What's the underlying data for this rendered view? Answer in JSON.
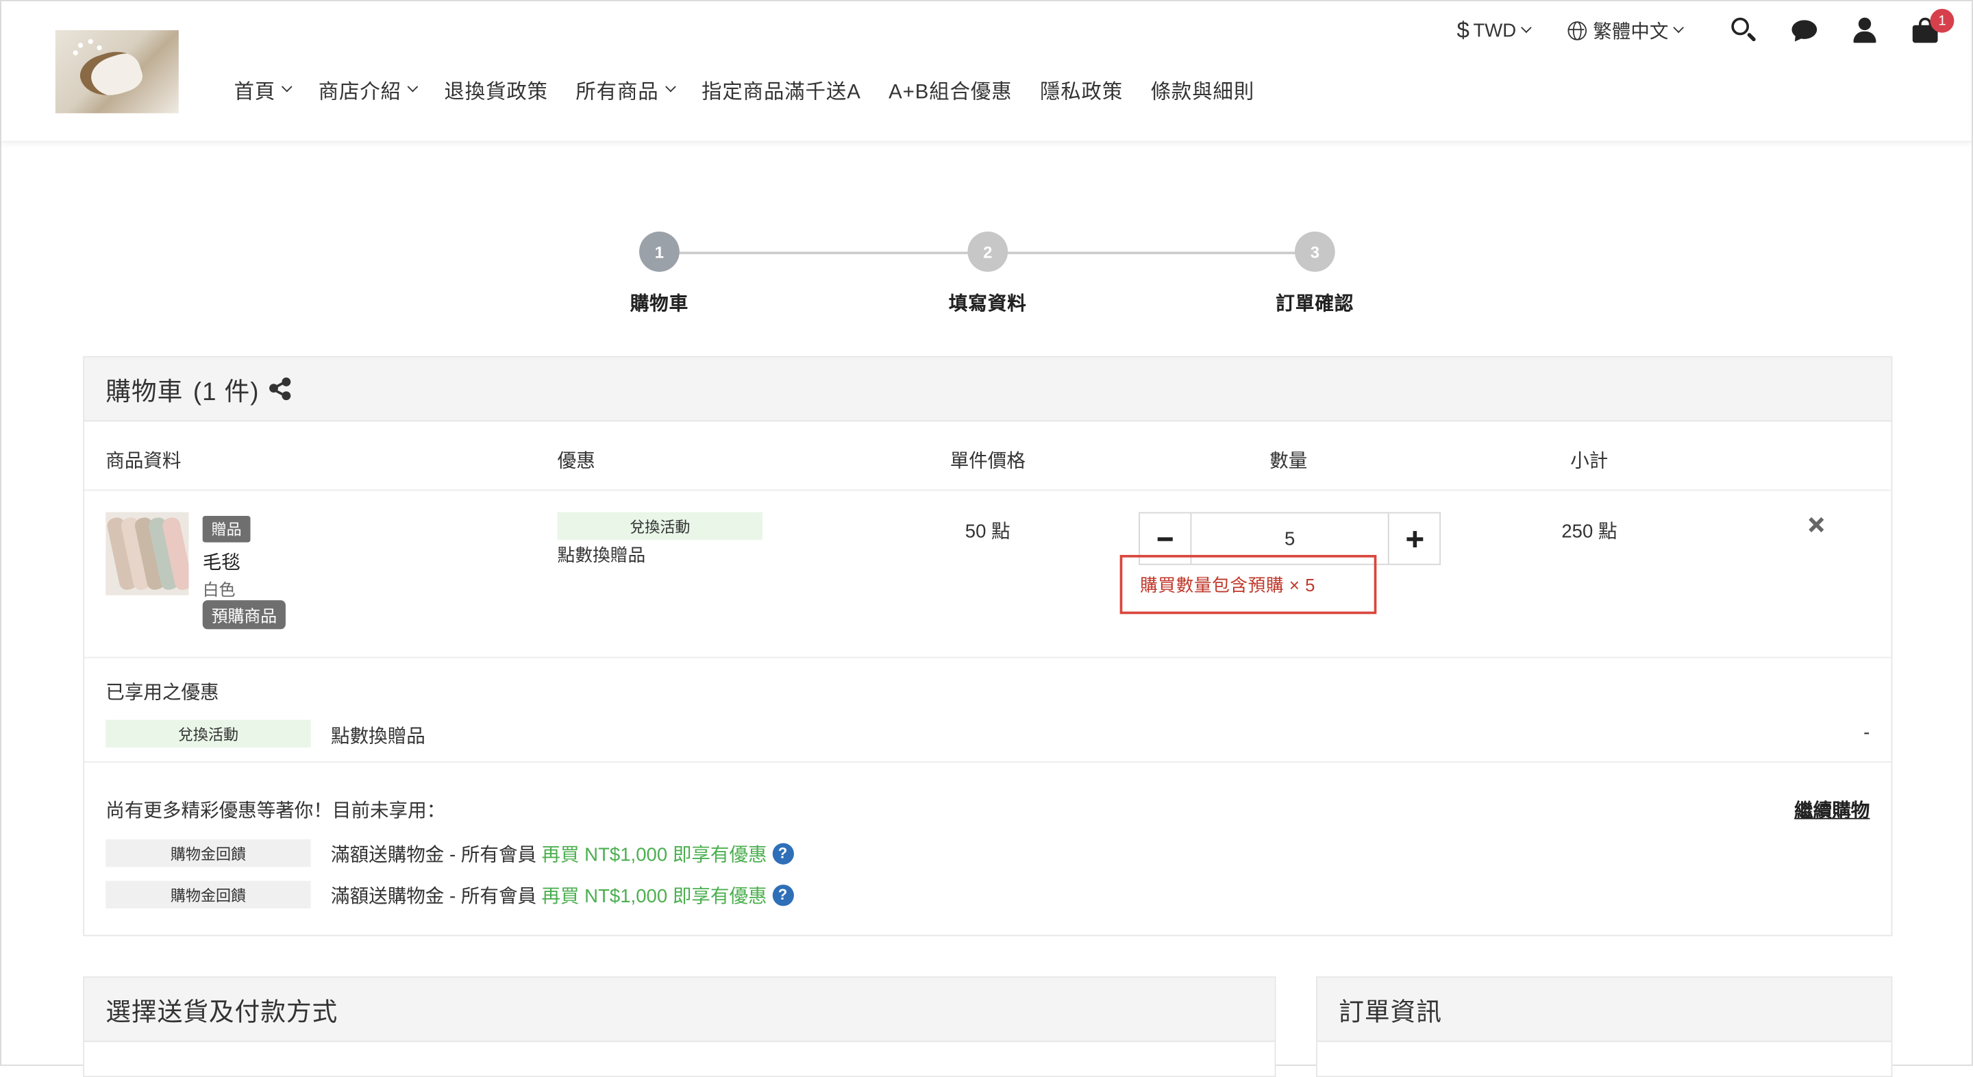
{
  "header": {
    "currency": "TWD",
    "currency_symbol": "$",
    "language": "繁體中文",
    "cart_count": "1",
    "nav": [
      {
        "label": "首頁",
        "has_dropdown": true
      },
      {
        "label": "商店介紹",
        "has_dropdown": true
      },
      {
        "label": "退換貨政策",
        "has_dropdown": false
      },
      {
        "label": "所有商品",
        "has_dropdown": true
      },
      {
        "label": "指定商品滿千送A",
        "has_dropdown": false
      },
      {
        "label": "A+B組合優惠",
        "has_dropdown": false
      },
      {
        "label": "隱私政策",
        "has_dropdown": false
      },
      {
        "label": "條款與細則",
        "has_dropdown": false
      }
    ]
  },
  "steps": [
    {
      "num": "1",
      "label": "購物車",
      "active": true
    },
    {
      "num": "2",
      "label": "填寫資料",
      "active": false
    },
    {
      "num": "3",
      "label": "訂單確認",
      "active": false
    }
  ],
  "cart": {
    "title": "購物車",
    "count_text": "(1 件)",
    "columns": {
      "product": "商品資料",
      "promo": "優惠",
      "unit_price": "單件價格",
      "qty": "數量",
      "subtotal": "小計"
    },
    "item": {
      "gift_tag": "贈品",
      "name": "毛毯",
      "variant": "白色",
      "preorder_tag": "預購商品",
      "promo_tag": "兌換活動",
      "promo_name": "點數換贈品",
      "unit_price": "50 點",
      "qty": "5",
      "subtotal": "250 點",
      "warning": "購買數量包含預購 × 5"
    },
    "applied": {
      "title": "已享用之優惠",
      "tag": "兌換活動",
      "name": "點數換贈品",
      "value": "-"
    },
    "more": {
      "title": "尚有更多精彩優惠等著你！目前未享用：",
      "continue_link": "繼續購物",
      "offers": [
        {
          "tag": "購物金回饋",
          "name": "滿額送購物金 - 所有會員",
          "hint": "再買 NT$1,000 即享有優惠"
        },
        {
          "tag": "購物金回饋",
          "name": "滿額送購物金 - 所有會員",
          "hint": "再買 NT$1,000 即享有優惠"
        }
      ]
    }
  },
  "shipping_panel": {
    "title": "選擇送貨及付款方式"
  },
  "order_panel": {
    "title": "訂單資訊"
  },
  "colors": {
    "step_active": "#9aa1a8",
    "step_inactive": "#c7c7c7",
    "warning": "#d9473d",
    "green_hint": "#4caf50",
    "badge": "#d6404c"
  }
}
